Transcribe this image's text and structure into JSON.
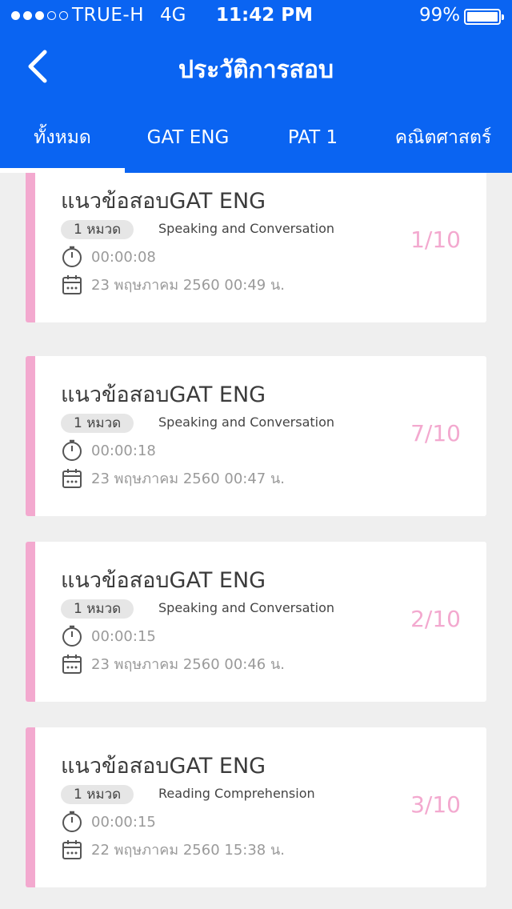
{
  "status_bar": {
    "carrier": "TRUE-H",
    "network": "4G",
    "time": "11:42 PM",
    "battery": "99%",
    "signal_bars_filled": 3,
    "signal_bars_total": 5
  },
  "header": {
    "title": "ประวัติการสอบ",
    "back_icon": "chevron-left-icon"
  },
  "tabs": [
    {
      "label": "ทั้งหมด",
      "active": true
    },
    {
      "label": "GAT ENG",
      "active": false
    },
    {
      "label": "PAT 1",
      "active": false
    },
    {
      "label": "คณิตศาสตร์",
      "active": false
    }
  ],
  "history": [
    {
      "title": "แนวข้อสอบGAT ENG",
      "badge": "1 หมวด",
      "topic": "Speaking and Conversation",
      "duration": "00:00:08",
      "date": "23 พฤษภาคม 2560 00:49 น.",
      "score": "1/10"
    },
    {
      "title": "แนวข้อสอบGAT ENG",
      "badge": "1 หมวด",
      "topic": "Speaking and Conversation",
      "duration": "00:00:18",
      "date": "23 พฤษภาคม 2560 00:47 น.",
      "score": "7/10"
    },
    {
      "title": "แนวข้อสอบGAT ENG",
      "badge": "1 หมวด",
      "topic": "Speaking and Conversation",
      "duration": "00:00:15",
      "date": "23 พฤษภาคม 2560 00:46 น.",
      "score": "2/10"
    },
    {
      "title": "แนวข้อสอบGAT ENG",
      "badge": "1 หมวด",
      "topic": "Reading Comprehension",
      "duration": "00:00:15",
      "date": "22 พฤษภาคม 2560 15:38 น.",
      "score": "3/10"
    }
  ],
  "colors": {
    "primary": "#0a64f2",
    "accent": "#f3a9cf",
    "background": "#efefef"
  }
}
